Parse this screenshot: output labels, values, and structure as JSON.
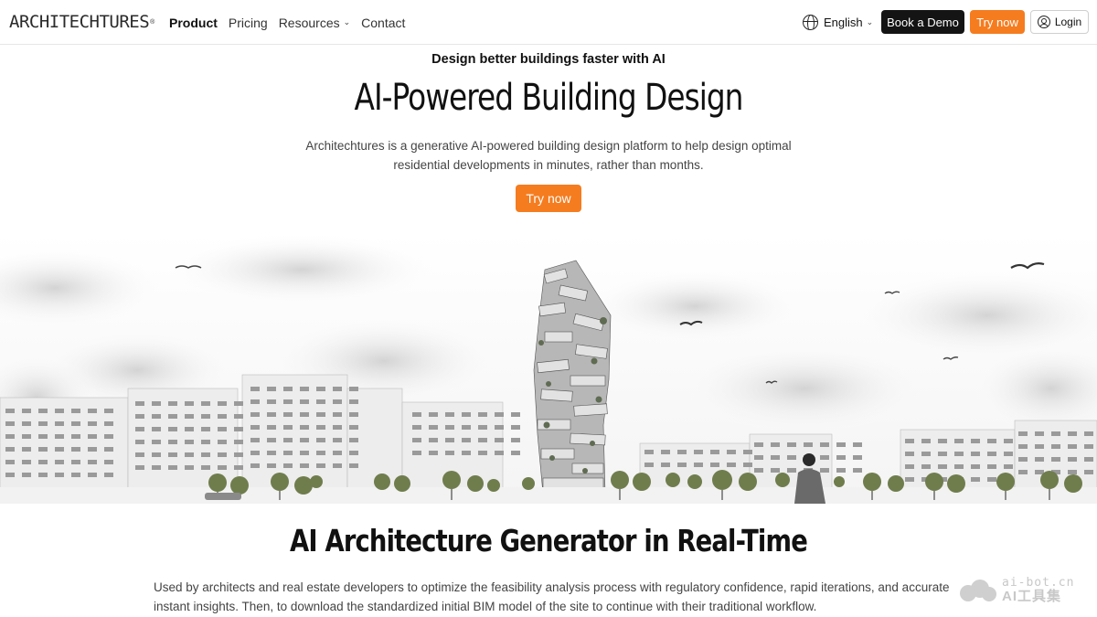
{
  "nav": {
    "logo_text": "ARCHITECHTURES",
    "logo_reg": "®",
    "links": [
      {
        "label": "Product",
        "active": true
      },
      {
        "label": "Pricing"
      },
      {
        "label": "Resources",
        "has_dropdown": true
      },
      {
        "label": "Contact"
      }
    ],
    "dropdown_chevron": "⌄",
    "language": "English",
    "book_demo": "Book a Demo",
    "try_now": "Try now",
    "login": "Login"
  },
  "hero": {
    "eyebrow": "Design better buildings faster with AI",
    "title": "AI-Powered Building Design",
    "description": "Architechtures is a generative AI-powered building design platform to help design optimal residential developments in minutes, rather than months.",
    "cta": "Try now"
  },
  "section": {
    "title": "AI Architecture Generator in Real-Time",
    "description": "Used by architects and real estate developers to optimize the feasibility analysis process with regulatory confidence, rapid iterations, and accurate instant insights. Then, to download the standardized initial BIM model of the site to continue with their traditional workflow."
  },
  "watermark": {
    "line1": "ai-bot.cn",
    "line2": "AI工具集"
  },
  "colors": {
    "accent": "#f57c1f",
    "dark_button": "#141414"
  }
}
